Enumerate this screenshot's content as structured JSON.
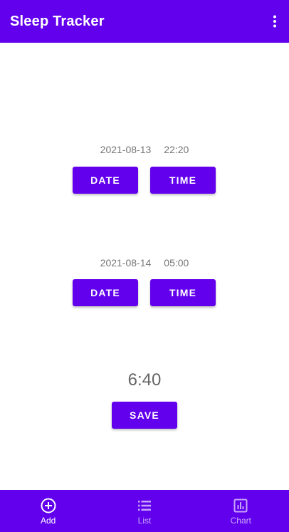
{
  "app_bar": {
    "title": "Sleep Tracker",
    "overflow_icon": "more-vert-icon"
  },
  "start": {
    "date": "2021-08-13",
    "time": "22:20",
    "date_button": "DATE",
    "time_button": "TIME"
  },
  "end": {
    "date": "2021-08-14",
    "time": "05:00",
    "date_button": "DATE",
    "time_button": "TIME"
  },
  "duration": "6:40",
  "save_button": "SAVE",
  "bottom_nav": {
    "items": [
      {
        "label": "Add",
        "icon": "add-circle-icon",
        "active": true
      },
      {
        "label": "List",
        "icon": "list-icon",
        "active": false
      },
      {
        "label": "Chart",
        "icon": "chart-icon",
        "active": false
      }
    ]
  },
  "colors": {
    "primary": "#6200ee",
    "on_primary": "#ffffff",
    "secondary_text": "#757575"
  }
}
